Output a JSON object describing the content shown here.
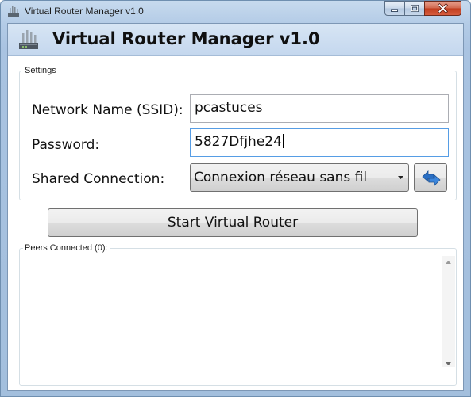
{
  "window": {
    "title": "Virtual Router Manager v1.0"
  },
  "header": {
    "title": "Virtual Router Manager v1.0"
  },
  "settings": {
    "group_label": "Settings",
    "network_name_label": "Network Name (SSID):",
    "network_name_value": "pcastuces",
    "password_label": "Password:",
    "password_value": "5827Dfjhe24",
    "shared_connection_label": "Shared Connection:",
    "shared_connection_value": "Connexion réseau sans fil"
  },
  "actions": {
    "start_label": "Start Virtual Router"
  },
  "peers": {
    "group_label": "Peers Connected (0):",
    "items": []
  },
  "icons": {
    "app": "router-icon",
    "refresh": "refresh-arrows-icon",
    "minimize": "minimize-icon",
    "maximize": "maximize-icon",
    "close": "close-icon"
  },
  "colors": {
    "title_bar": "#b3cbe6",
    "header_band": "#c4d7ee",
    "close_button": "#c13d1e",
    "focus_border": "#569de5",
    "refresh_arrow": "#2a6fc4"
  }
}
